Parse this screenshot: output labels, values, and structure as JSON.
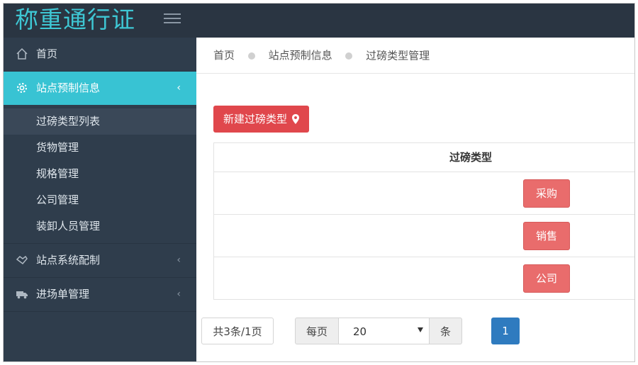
{
  "app": {
    "logo": "称重通行证"
  },
  "sidebar": {
    "items": [
      {
        "label": "首页",
        "icon": "home-icon"
      },
      {
        "label": "站点预制信息",
        "icon": "gear-icon",
        "active": true
      },
      {
        "label": "站点系统配制",
        "icon": "handshake-icon"
      },
      {
        "label": "进场单管理",
        "icon": "truck-icon"
      }
    ],
    "submenu": [
      {
        "label": "过磅类型列表",
        "current": true
      },
      {
        "label": "货物管理"
      },
      {
        "label": "规格管理"
      },
      {
        "label": "公司管理"
      },
      {
        "label": "装卸人员管理"
      }
    ]
  },
  "breadcrumb": [
    "首页",
    "站点预制信息",
    "过磅类型管理"
  ],
  "toolbar": {
    "new_label": "新建过磅类型"
  },
  "table": {
    "header": "过磅类型",
    "rows": [
      "采购",
      "销售",
      "公司"
    ]
  },
  "pagination": {
    "total_text": "共3条/1页",
    "per_page_label": "每页",
    "per_page_value": "20",
    "per_page_unit": "条",
    "current_page": "1"
  },
  "colors": {
    "topbar": "#2a3542",
    "sidebar": "#2f3d4c",
    "accent": "#38c3d3",
    "danger": "#e0474c",
    "primary": "#2f7bbf"
  }
}
